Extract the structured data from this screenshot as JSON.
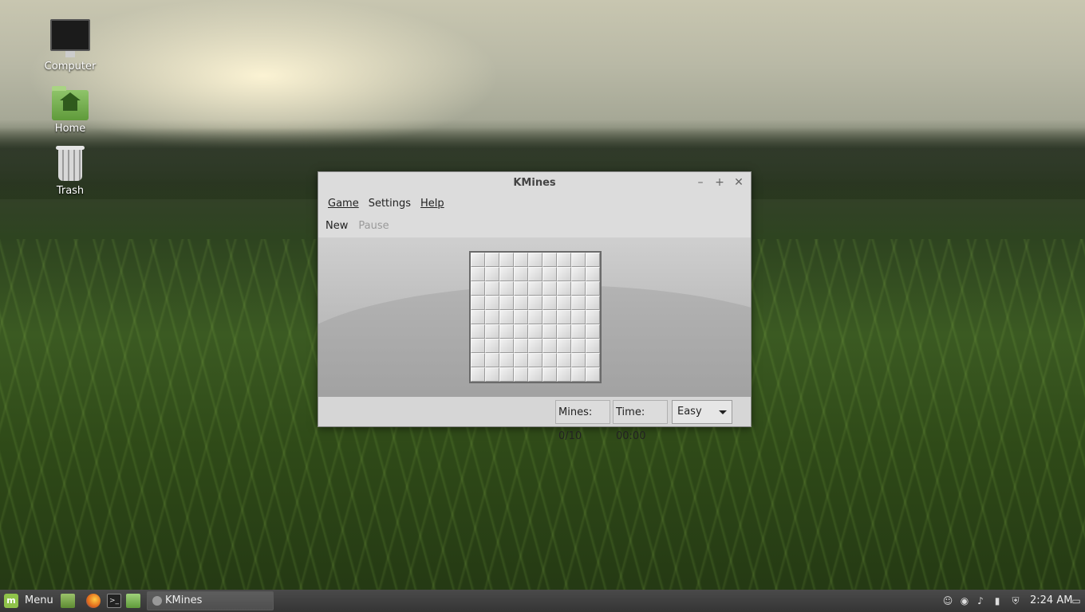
{
  "desktop": {
    "icons": [
      {
        "label": "Computer"
      },
      {
        "label": "Home"
      },
      {
        "label": "Trash"
      }
    ]
  },
  "window": {
    "title": "KMines",
    "controls": {
      "minimize": "–",
      "maximize": "+",
      "close": "✕"
    },
    "menu": {
      "game": "Game",
      "settings": "Settings",
      "help": "Help"
    },
    "toolbar": {
      "new": "New",
      "pause": "Pause"
    },
    "board": {
      "rows": 9,
      "cols": 9
    },
    "status": {
      "mines": "Mines: 0/10",
      "time": "Time: 00:00",
      "difficulty": "Easy"
    }
  },
  "taskbar": {
    "menu_label": "Menu",
    "logo": "m",
    "active_task": "KMines",
    "clock": "2:24 AM",
    "launchers": [
      "show-desktop-icon",
      "firefox-icon",
      "terminal-icon",
      "files-icon"
    ],
    "tray": [
      "user-icon",
      "wifi-icon",
      "volume-icon",
      "battery-icon",
      "shield-icon",
      "display-icon"
    ]
  }
}
